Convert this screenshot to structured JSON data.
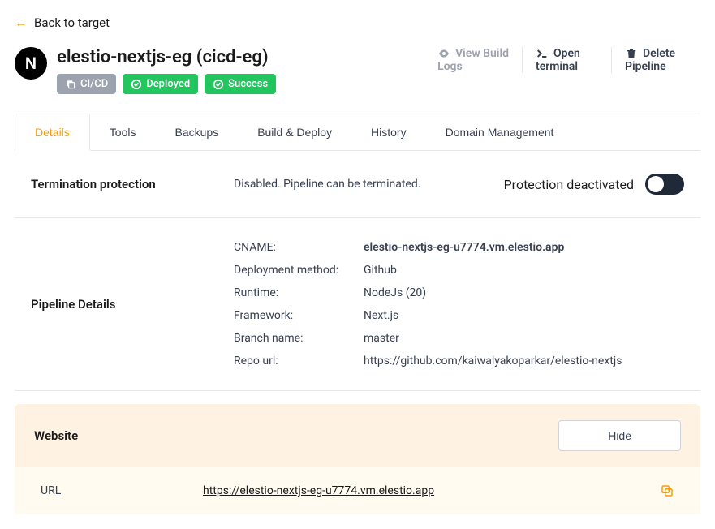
{
  "nav": {
    "back": "Back to target"
  },
  "header": {
    "logo_letter": "N",
    "title": "elestio-nextjs-eg (cicd-eg)",
    "badges": {
      "cicd": "CI/CD",
      "deployed": "Deployed",
      "success": "Success"
    },
    "actions": {
      "logs_l1": "View Build",
      "logs_l2": "Logs",
      "term_l1": "Open",
      "term_l2": "terminal",
      "del_l1": "Delete",
      "del_l2": "Pipeline"
    }
  },
  "tabs": [
    "Details",
    "Tools",
    "Backups",
    "Build & Deploy",
    "History",
    "Domain Management"
  ],
  "termination": {
    "label": "Termination protection",
    "status": "Disabled. Pipeline can be terminated.",
    "right": "Protection deactivated"
  },
  "pipeline": {
    "label": "Pipeline Details",
    "rows": {
      "cname_k": "CNAME:",
      "cname_v": "elestio-nextjs-eg-u7774.vm.elestio.app",
      "deploy_k": "Deployment method:",
      "deploy_v": "Github",
      "runtime_k": "Runtime:",
      "runtime_v": "NodeJs (20)",
      "fw_k": "Framework:",
      "fw_v": "Next.js",
      "branch_k": "Branch name:",
      "branch_v": "master",
      "repo_k": "Repo url:",
      "repo_v": "https://github.com/kaiwalyakoparkar/elestio-nextjs"
    }
  },
  "website": {
    "label": "Website",
    "hide": "Hide",
    "url_label": "URL",
    "url": "https://elestio-nextjs-eg-u7774.vm.elestio.app"
  }
}
